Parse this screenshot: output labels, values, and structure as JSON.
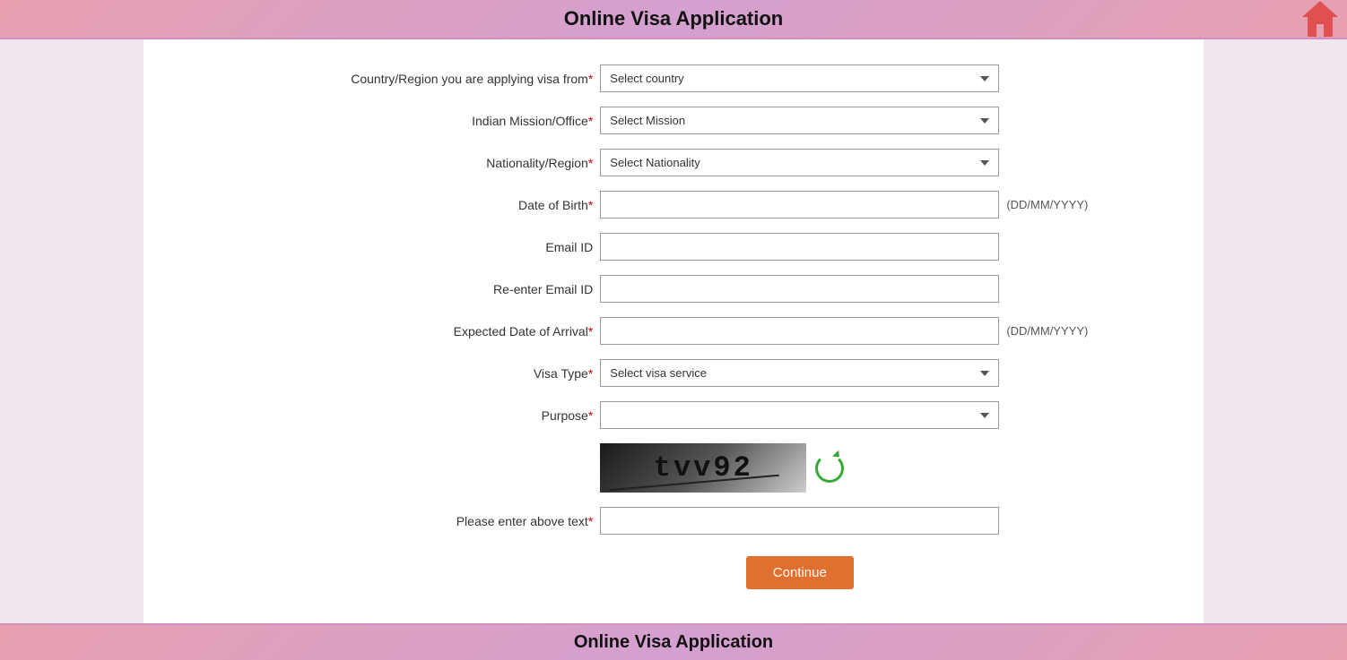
{
  "header": {
    "title": "Online Visa Application",
    "home_icon": "home-icon"
  },
  "footer": {
    "title": "Online Visa Application"
  },
  "form": {
    "fields": [
      {
        "id": "country-region",
        "label": "Country/Region you are applying visa from",
        "required": true,
        "type": "select",
        "placeholder": "Select country",
        "hint": ""
      },
      {
        "id": "indian-mission",
        "label": "Indian Mission/Office",
        "required": true,
        "type": "select",
        "placeholder": "Select Mission",
        "hint": ""
      },
      {
        "id": "nationality",
        "label": "Nationality/Region",
        "required": true,
        "type": "select",
        "placeholder": "Select Nationality",
        "hint": ""
      },
      {
        "id": "dob",
        "label": "Date of Birth",
        "required": true,
        "type": "text",
        "placeholder": "",
        "hint": "(DD/MM/YYYY)"
      },
      {
        "id": "email",
        "label": "Email ID",
        "required": false,
        "type": "text",
        "placeholder": "",
        "hint": ""
      },
      {
        "id": "re-email",
        "label": "Re-enter Email ID",
        "required": false,
        "type": "text",
        "placeholder": "",
        "hint": ""
      },
      {
        "id": "arrival-date",
        "label": "Expected Date of Arrival",
        "required": true,
        "type": "text",
        "placeholder": "",
        "hint": "(DD/MM/YYYY)"
      },
      {
        "id": "visa-type",
        "label": "Visa Type",
        "required": true,
        "type": "select",
        "placeholder": "Select visa service",
        "hint": ""
      },
      {
        "id": "purpose",
        "label": "Purpose",
        "required": true,
        "type": "select",
        "placeholder": "",
        "hint": ""
      }
    ],
    "captcha": {
      "text": "tvv92",
      "label": "Please enter above text",
      "required": true
    },
    "continue_button": "Continue"
  }
}
